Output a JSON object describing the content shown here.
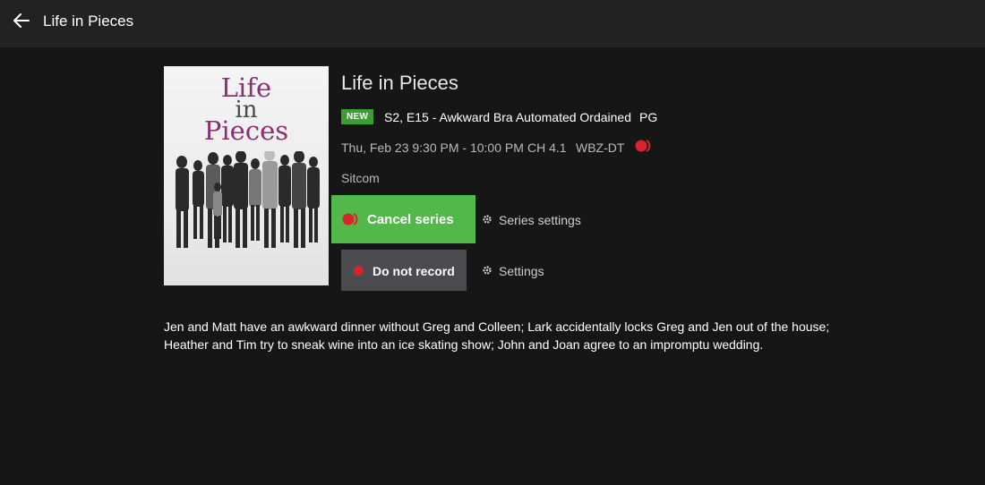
{
  "header": {
    "title": "Life in Pieces",
    "back_icon": "arrow-left-icon"
  },
  "poster": {
    "logo_line1": "Life",
    "logo_line2": "in",
    "logo_line3": "Pieces",
    "logo_color": "#8a2f6f"
  },
  "program": {
    "title": "Life in Pieces",
    "badge": "NEW",
    "episode": "S2, E15 - Awkward Bra Automated Ordained",
    "rating": "PG",
    "datetime": "Thu, Feb 23 9:30 PM - 10:00 PM",
    "channel": "CH 4.1",
    "station": "WBZ-DT",
    "genre": "Sitcom",
    "description": "Jen and Matt have an awkward dinner without Greg and Colleen; Lark accidentally locks Greg and Jen out of the house; Heather and Tim try to sneak wine into an ice skating show; John and Joan agree to an impromptu wedding."
  },
  "actions": {
    "cancel_series": "Cancel series",
    "series_settings": "Series settings",
    "do_not_record": "Do not record",
    "settings": "Settings"
  },
  "colors": {
    "accent_green": "#52b84a",
    "new_badge": "#3f9c35",
    "record_red": "#d6262b",
    "background": "#161616",
    "topbar": "#222222"
  }
}
